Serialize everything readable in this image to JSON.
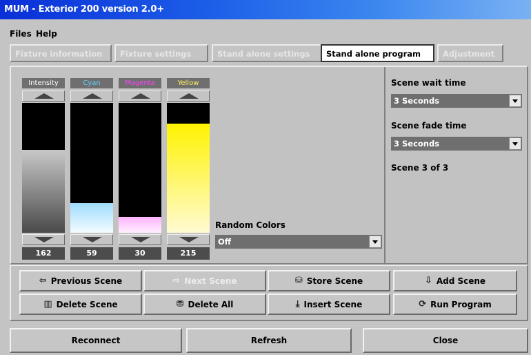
{
  "window": {
    "title": "MUM - Exterior 200 version 2.0+"
  },
  "menu": {
    "files": "Files",
    "help": "Help"
  },
  "tabs": [
    {
      "label": "Fixture information",
      "active": false
    },
    {
      "label": "Fixture settings",
      "active": false
    },
    {
      "label": "Stand alone settings",
      "active": false
    },
    {
      "label": "Stand alone program",
      "active": true
    },
    {
      "label": "Adjustment",
      "active": false
    }
  ],
  "sliders": [
    {
      "label": "Intensity",
      "label_color": "#ffffff",
      "value": "162",
      "level": 0.64,
      "fill": "linear-gradient(to bottom, #c8c8c8, #4a4a4a)"
    },
    {
      "label": "Cyan",
      "label_color": "#5fd0ff",
      "value": "59",
      "level": 0.23,
      "fill": "linear-gradient(to bottom, #9fdcff, #f4fbff)"
    },
    {
      "label": "Magenta",
      "label_color": "#ff40ff",
      "value": "30",
      "level": 0.12,
      "fill": "linear-gradient(to bottom, #ffb2ff, #fff0ff)"
    },
    {
      "label": "Yellow",
      "label_color": "#fff060",
      "value": "215",
      "level": 0.84,
      "fill": "linear-gradient(to bottom, #fff200, #fffbd2)"
    }
  ],
  "random_colors": {
    "label": "Random Colors",
    "value": "Off"
  },
  "scene": {
    "wait_label": "Scene wait time",
    "wait_value": "3 Seconds",
    "fade_label": "Scene fade time",
    "fade_value": "3 Seconds",
    "counter": "Scene 3 of 3"
  },
  "buttons": {
    "previous_scene": "Previous Scene",
    "next_scene": "Next Scene",
    "store_scene": "Store Scene",
    "add_scene": "Add Scene",
    "delete_scene": "Delete Scene",
    "delete_all": "Delete All",
    "insert_scene": "Insert Scene",
    "run_program": "Run Program"
  },
  "footer": {
    "reconnect": "Reconnect",
    "refresh": "Refresh",
    "close": "Close"
  }
}
